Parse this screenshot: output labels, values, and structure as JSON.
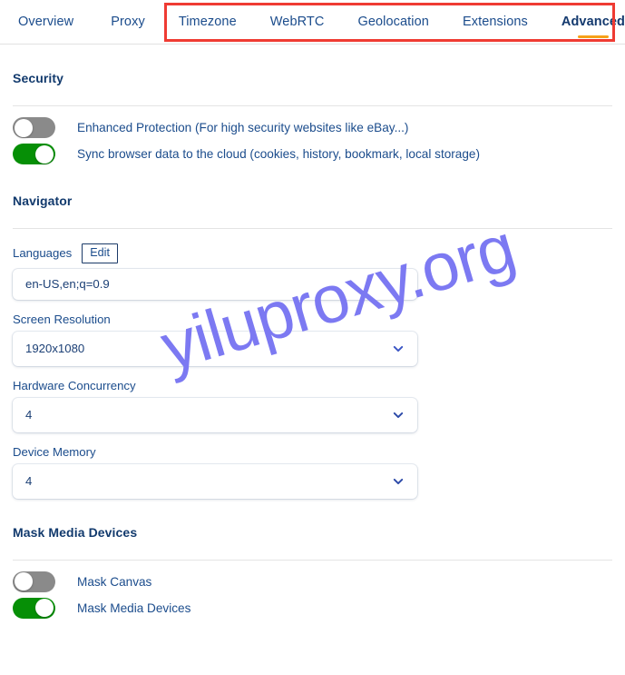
{
  "tabs": [
    {
      "label": "Overview",
      "active": false
    },
    {
      "label": "Proxy",
      "active": false
    },
    {
      "label": "Timezone",
      "active": false
    },
    {
      "label": "WebRTC",
      "active": false
    },
    {
      "label": "Geolocation",
      "active": false
    },
    {
      "label": "Extensions",
      "active": false
    },
    {
      "label": "Advanced",
      "active": true
    }
  ],
  "sections": {
    "security": {
      "title": "Security",
      "toggles": [
        {
          "label": "Enhanced Protection (For high security websites like eBay...)",
          "state": "off"
        },
        {
          "label": "Sync browser data to the cloud (cookies, history, bookmark, local storage)",
          "state": "on"
        }
      ]
    },
    "navigator": {
      "title": "Navigator",
      "languages": {
        "label": "Languages",
        "edit_label": "Edit",
        "value": "en-US,en;q=0.9"
      },
      "screen_resolution": {
        "label": "Screen Resolution",
        "value": "1920x1080"
      },
      "hardware_concurrency": {
        "label": "Hardware Concurrency",
        "value": "4"
      },
      "device_memory": {
        "label": "Device Memory",
        "value": "4"
      }
    },
    "mask_media": {
      "title": "Mask Media Devices",
      "toggles": [
        {
          "label": "Mask Canvas",
          "state": "off"
        },
        {
          "label": "Mask Media Devices",
          "state": "on"
        }
      ]
    }
  },
  "watermark": {
    "text": "yiluproxy.org"
  },
  "annotation": {
    "type": "red-rectangle-highlight"
  },
  "colors": {
    "accent_underline": "#f6a118",
    "toggle_on": "#068f06",
    "toggle_off": "#8a8a8a",
    "heading": "#123a6d",
    "link_text": "#1b4c8c",
    "annotation_red": "#ef3b33",
    "watermark": "#7c79f2"
  }
}
